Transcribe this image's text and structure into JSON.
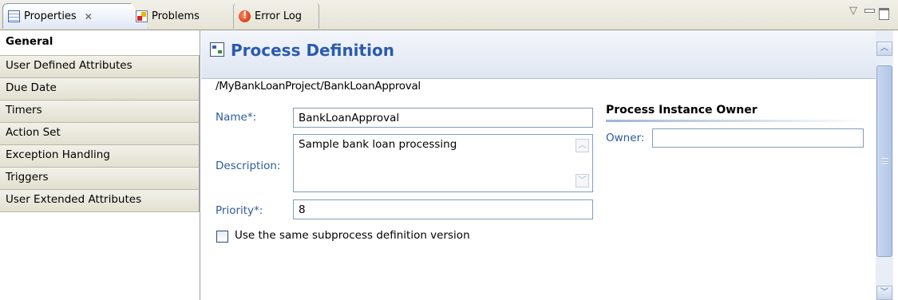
{
  "tabs": [
    {
      "label": "Properties",
      "icon": "properties-icon",
      "active": true
    },
    {
      "label": "Problems",
      "icon": "problems-icon"
    },
    {
      "label": "Error Log",
      "icon": "error-log-icon"
    }
  ],
  "nav": {
    "items": [
      {
        "label": "General",
        "selected": true
      },
      {
        "label": "User Defined Attributes"
      },
      {
        "label": "Due Date"
      },
      {
        "label": "Timers"
      },
      {
        "label": "Action Set"
      },
      {
        "label": "Exception Handling"
      },
      {
        "label": "Triggers"
      },
      {
        "label": "User Extended Attributes"
      }
    ]
  },
  "header": {
    "title": "Process Definition",
    "icon": "process-definition-icon"
  },
  "path": "/MyBankLoanProject/BankLoanApproval",
  "form": {
    "name_label": "Name*:",
    "name_value": "BankLoanApproval",
    "description_label": "Description:",
    "description_value": "Sample bank loan processing",
    "priority_label": "Priority*:",
    "priority_value": "8",
    "checkbox_label": "Use the same subprocess definition version",
    "checkbox_checked": false
  },
  "owner_section": {
    "title": "Process Instance Owner",
    "owner_label": "Owner:",
    "owner_value": ""
  },
  "colors": {
    "accent": "#2a5bb0",
    "label": "#2d5aa0",
    "field_border": "#7f9db9"
  }
}
